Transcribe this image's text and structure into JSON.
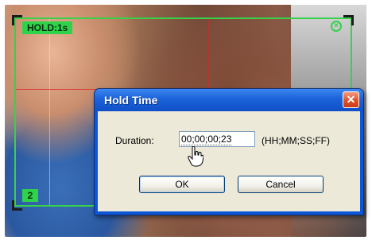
{
  "video_frame": {
    "hold_label": "HOLD:1s",
    "clip_number": "2"
  },
  "dialog": {
    "title": "Hold Time",
    "close_glyph": "✕",
    "duration_label": "Duration:",
    "duration_value": "00;00;00;23",
    "format_hint": "(HH;MM;SS;FF)",
    "ok_label": "OK",
    "cancel_label": "Cancel"
  },
  "colors": {
    "overlay_green": "#36d24a",
    "title_bar_blue": "#1b62d8",
    "close_red": "#e0512a",
    "dialog_bg": "#ece9d8"
  },
  "icons": [
    "close-icon",
    "hand-cursor-icon",
    "clear-circle-icon"
  ]
}
